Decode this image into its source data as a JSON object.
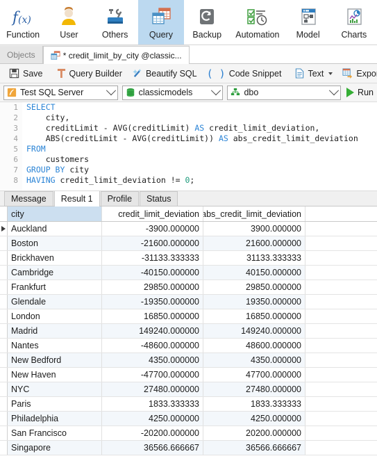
{
  "ribbon": {
    "items": [
      {
        "label": "Function",
        "icon": "function-fx-icon"
      },
      {
        "label": "User",
        "icon": "user-icon"
      },
      {
        "label": "Others",
        "icon": "others-tools-icon"
      },
      {
        "label": "Query",
        "icon": "query-table-icon"
      },
      {
        "label": "Backup",
        "icon": "backup-disk-icon"
      },
      {
        "label": "Automation",
        "icon": "automation-checklist-clock-icon"
      },
      {
        "label": "Model",
        "icon": "model-diagram-icon"
      },
      {
        "label": "Charts",
        "icon": "charts-icon"
      }
    ],
    "active": "Query"
  },
  "tabs": {
    "objects_label": "Objects",
    "document_label": "* credit_limit_by_city @classic...",
    "document_icon": "query-table-icon"
  },
  "query_toolbar": {
    "save": "Save",
    "query_builder": "Query Builder",
    "beautify_sql": "Beautify SQL",
    "code_snippet": "Code Snippet",
    "text": "Text",
    "export_result": "Export Result"
  },
  "connection": {
    "server": "Test SQL Server",
    "database": "classicmodels",
    "schema": "dbo",
    "run_label": "Run"
  },
  "editor": {
    "line_numbers": [
      "1",
      "2",
      "3",
      "4",
      "5",
      "6",
      "7",
      "8"
    ],
    "lines": [
      [
        {
          "t": "SELECT",
          "k": "kw"
        }
      ],
      [
        {
          "t": "    city,",
          "k": ""
        }
      ],
      [
        {
          "t": "    creditLimit - AVG(creditLimit) ",
          "k": ""
        },
        {
          "t": "AS",
          "k": "kw"
        },
        {
          "t": " credit_limit_deviation,",
          "k": ""
        }
      ],
      [
        {
          "t": "    ABS(creditLimit - AVG(creditLimit)) ",
          "k": ""
        },
        {
          "t": "AS",
          "k": "kw"
        },
        {
          "t": " abs_credit_limit_deviation",
          "k": ""
        }
      ],
      [
        {
          "t": "FROM",
          "k": "kw"
        }
      ],
      [
        {
          "t": "    customers",
          "k": ""
        }
      ],
      [
        {
          "t": "GROUP BY",
          "k": "kw"
        },
        {
          "t": " city",
          "k": ""
        }
      ],
      [
        {
          "t": "HAVING",
          "k": "kw"
        },
        {
          "t": " credit_limit_deviation != ",
          "k": ""
        },
        {
          "t": "0",
          "k": "num"
        },
        {
          "t": ";",
          "k": ""
        }
      ]
    ]
  },
  "result_tabs": {
    "items": [
      "Message",
      "Result 1",
      "Profile",
      "Status"
    ],
    "selected": "Result 1"
  },
  "grid": {
    "columns": [
      "city",
      "credit_limit_deviation",
      "abs_credit_limit_deviation"
    ],
    "selected_row": 0,
    "rows": [
      [
        "Auckland",
        "-3900.000000",
        "3900.000000"
      ],
      [
        "Boston",
        "-21600.000000",
        "21600.000000"
      ],
      [
        "Brickhaven",
        "-31133.333333",
        "31133.333333"
      ],
      [
        "Cambridge",
        "-40150.000000",
        "40150.000000"
      ],
      [
        "Frankfurt",
        "29850.000000",
        "29850.000000"
      ],
      [
        "Glendale",
        "-19350.000000",
        "19350.000000"
      ],
      [
        "London",
        "16850.000000",
        "16850.000000"
      ],
      [
        "Madrid",
        "149240.000000",
        "149240.000000"
      ],
      [
        "Nantes",
        "-48600.000000",
        "48600.000000"
      ],
      [
        "New Bedford",
        "4350.000000",
        "4350.000000"
      ],
      [
        "New Haven",
        "-47700.000000",
        "47700.000000"
      ],
      [
        "NYC",
        "27480.000000",
        "27480.000000"
      ],
      [
        "Paris",
        "1833.333333",
        "1833.333333"
      ],
      [
        "Philadelphia",
        "4250.000000",
        "4250.000000"
      ],
      [
        "San Francisco",
        "-20200.000000",
        "20200.000000"
      ],
      [
        "Singapore",
        "36566.666667",
        "36566.666667"
      ]
    ]
  },
  "colors": {
    "ribbon_active": "#bcd9f0",
    "header_selected": "#ccdff0",
    "run_green": "#35ae35",
    "keyword_blue": "#2b84d6"
  }
}
